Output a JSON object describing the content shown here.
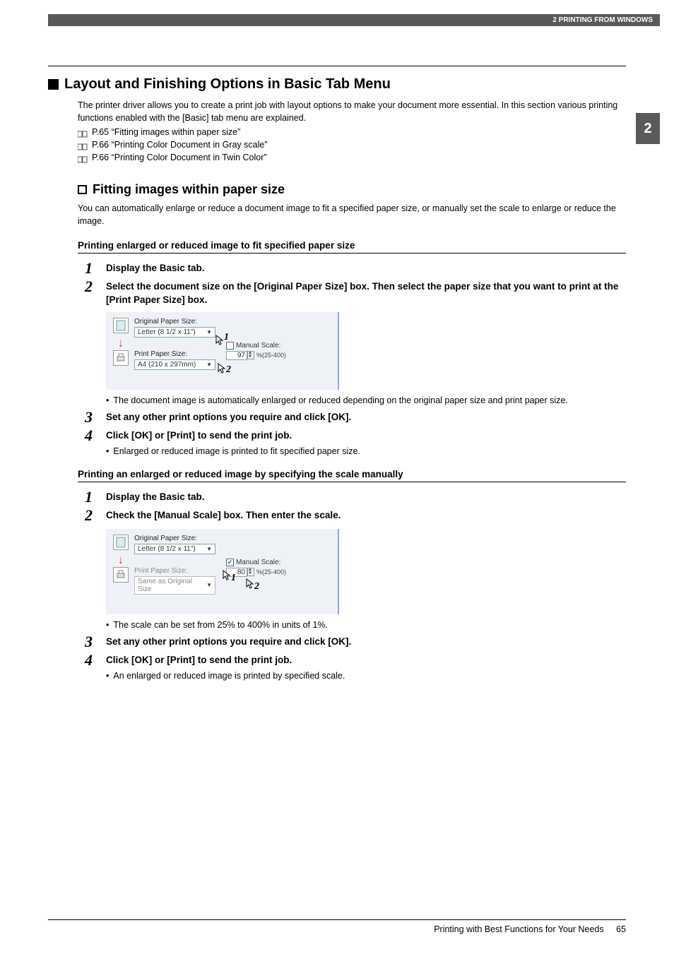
{
  "header": {
    "breadcrumb": "2 PRINTING FROM WINDOWS"
  },
  "chapter_tab": "2",
  "h1": "Layout and Finishing Options in Basic Tab Menu",
  "intro": "The printer driver allows you to create a print job with layout options to make your document more essential.  In this section various printing functions enabled with the [Basic] tab menu are explained.",
  "xrefs": [
    "P.65 “Fitting images within paper size”",
    "P.66 “Printing Color Document in Gray scale”",
    "P.66 “Printing Color Document in Twin Color”"
  ],
  "h2": "Fitting images within paper size",
  "h2_body": "You can automatically enlarge or reduce a document image to fit a specified paper size, or manually set the scale to enlarge or reduce the image.",
  "section_a": {
    "h3": "Printing enlarged or reduced image to fit specified paper size",
    "steps": {
      "s1": "Display the Basic tab.",
      "s2": "Select the document size on the [Original Paper Size] box.  Then select the paper size that you want to print at the [Print Paper Size] box.",
      "s2_note": "The document image is automatically enlarged or reduced depending on the original paper size and print paper size.",
      "s3": "Set any other print options you require and click [OK].",
      "s4": "Click [OK] or [Print] to send the print job.",
      "s4_note": "Enlarged or reduced image is printed to fit specified paper size."
    },
    "screenshot": {
      "orig_label": "Original Paper Size:",
      "orig_value": "Letter (8 1/2 x 11\")",
      "print_label": "Print Paper Size:",
      "print_value": "A4 (210 x 297mm)",
      "manual_label": "Manual Scale:",
      "manual_checked": false,
      "scale_value": "97",
      "scale_range": "%(25-400)",
      "callout1": "1",
      "callout2": "2"
    }
  },
  "section_b": {
    "h3": "Printing an enlarged or reduced image by specifying the scale manually",
    "steps": {
      "s1": "Display the Basic tab.",
      "s2": "Check the [Manual Scale] box. Then enter the scale.",
      "s2_note": "The scale can be set from 25% to 400% in units of 1%.",
      "s3": "Set any other print options you require and click [OK].",
      "s4": "Click [OK] or [Print] to send the print job.",
      "s4_note": "An enlarged or reduced image is printed by specified scale."
    },
    "screenshot": {
      "orig_label": "Original Paper Size:",
      "orig_value": "Letter (8 1/2 x 11\")",
      "print_label": "Print Paper Size:",
      "print_value": "Same as Original Size",
      "manual_label": "Manual Scale:",
      "manual_checked": true,
      "scale_value": "80",
      "scale_range": "%(25-400)",
      "callout1": "1",
      "callout2": "2"
    }
  },
  "footer": {
    "text": "Printing with Best Functions for Your Needs",
    "page": "65"
  }
}
